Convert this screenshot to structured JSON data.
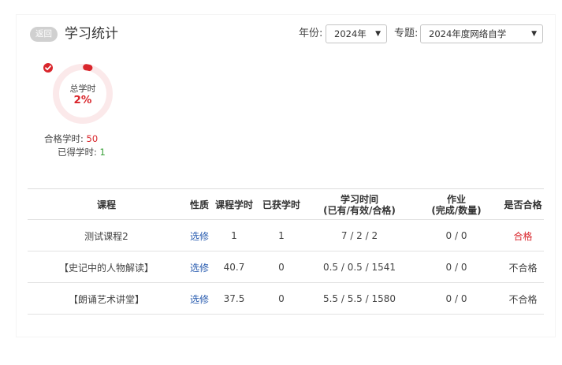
{
  "header": {
    "back_label": "返回",
    "title": "学习统计"
  },
  "filters": {
    "year_label": "年份:",
    "year_value": "2024年",
    "topic_label": "专题:",
    "topic_value": "2024年度网络自学"
  },
  "summary": {
    "ring_label": "总学时",
    "ring_value": "2%",
    "progress_percent": 2,
    "qualified_label": "合格学时:",
    "qualified_value": "50",
    "earned_label": "已得学时:",
    "earned_value": "1"
  },
  "colors": {
    "accent": "#d9262c",
    "link": "#2a5db0",
    "earned": "#3aa13a",
    "ring_track": "#fbe9ea"
  },
  "table": {
    "headers": {
      "course": "课程",
      "type": "性质",
      "course_hours": "课程学时",
      "earned_hours": "已获学时",
      "study_time": "学习时间",
      "study_time_sub": "(已有/有效/合格)",
      "homework": "作业",
      "homework_sub": "(完成/数量)",
      "passed": "是否合格"
    },
    "rows": [
      {
        "course": "测试课程2",
        "type": "选修",
        "course_hours": "1",
        "earned_hours": "1",
        "study_time": "7 / 2 / 2",
        "homework": "0 / 0",
        "passed": "合格"
      },
      {
        "course": "【史记中的人物解读】",
        "type": "选修",
        "course_hours": "40.7",
        "earned_hours": "0",
        "study_time": "0.5 / 0.5 / 1541",
        "homework": "0 / 0",
        "passed": "不合格"
      },
      {
        "course": "【朗诵艺术讲堂】",
        "type": "选修",
        "course_hours": "37.5",
        "earned_hours": "0",
        "study_time": "5.5 / 5.5 / 1580",
        "homework": "0 / 0",
        "passed": "不合格"
      }
    ]
  }
}
